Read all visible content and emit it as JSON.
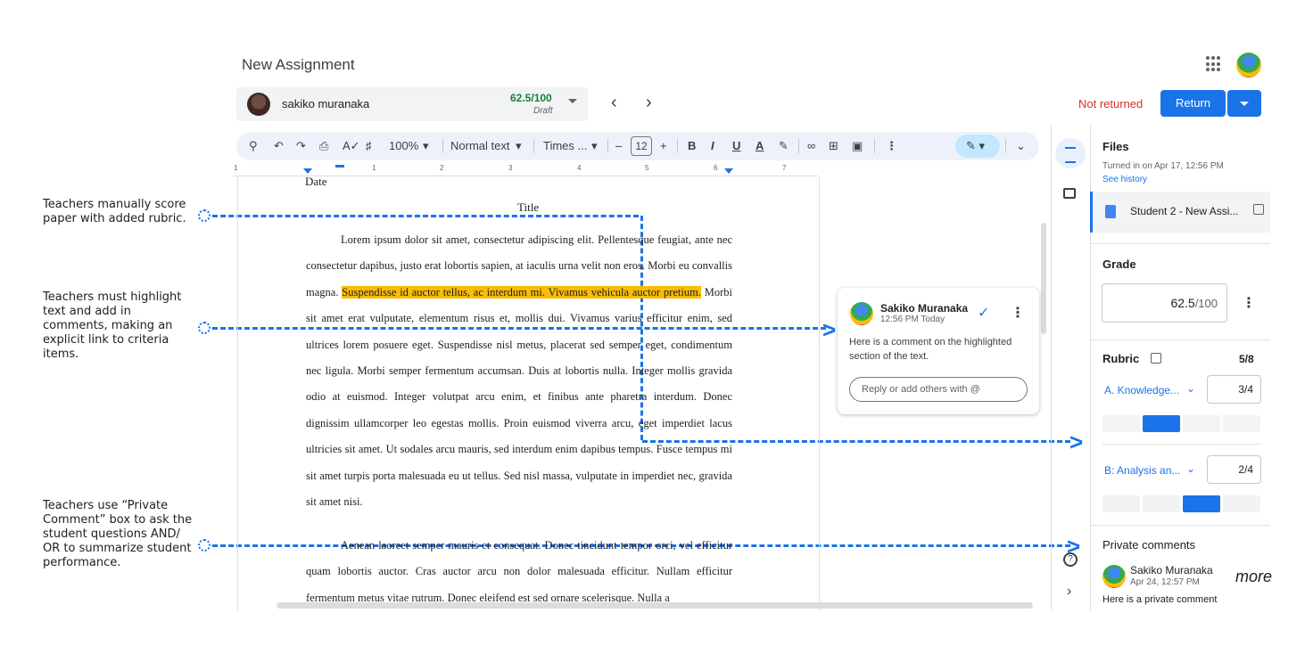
{
  "annotations": [
    {
      "text": "Teachers manually score paper with added rubric."
    },
    {
      "text": "Teachers must highlight text and add in comments, making an explicit link to criteria items."
    },
    {
      "text": "Teachers use “Private Comment” box to ask the student questions AND/ OR to summarize student performance."
    }
  ],
  "header": {
    "title": "New Assignment",
    "status": "Not returned",
    "return_label": "Return"
  },
  "student": {
    "name": "sakiko muranaka",
    "score": "62.5/100",
    "state": "Draft"
  },
  "toolbar": {
    "zoom": "100%",
    "style": "Normal text",
    "font": "Times ...",
    "size": "12",
    "bold": "B",
    "italic": "I",
    "underline": "U",
    "color": "A"
  },
  "ruler": [
    "1",
    "1",
    "2",
    "3",
    "4",
    "5",
    "6",
    "7"
  ],
  "document": {
    "date": "Date",
    "title": "Title",
    "p1_pre": "Lorem ipsum dolor sit amet, consectetur adipiscing elit. Pellentesque feugiat, ante nec consectetur dapibus, justo erat lobortis sapien, at iaculis urna velit non eros. Morbi eu convallis magna. ",
    "p1_highlight": "Suspendisse id auctor tellus, ac interdum mi. Vivamus vehicula auctor pretium.",
    "p1_post": " Morbi sit amet erat vulputate, elementum risus et, mollis dui. Vivamus varius efficitur enim, sed ultrices lorem posuere eget. Suspendisse nisl metus, placerat sed semper eget, condimentum nec ligula. Morbi semper fermentum accumsan. Duis at lobortis nulla. Integer mollis gravida odio at euismod. Integer volutpat arcu enim, et finibus ante pharetra interdum. Donec dignissim ullamcorper leo egestas mollis. Proin euismod viverra arcu, eget imperdiet lacus ultricies sit amet. Ut sodales arcu mauris, sed interdum enim dapibus tempus. Fusce tempus mi sit amet turpis porta malesuada eu ut tellus. Sed nisl massa, vulputate in imperdiet nec, gravida sit amet nisi.",
    "p2": "Aenean laoreet semper mauris et consequat. Donec tincidunt tempor orci, vel efficitur quam lobortis auctor. Cras auctor arcu non dolor malesuada efficitur. Nullam efficitur fermentum metus vitae rutrum. Donec eleifend est sed ornare scelerisque. Nulla a"
  },
  "comment": {
    "author": "Sakiko Muranaka",
    "time": "12:56 PM Today",
    "body": "Here is a comment on the highlighted section of the text.",
    "reply_placeholder": "Reply or add others with @"
  },
  "panel": {
    "files_title": "Files",
    "turned_in": "Turned in on Apr 17, 12:56 PM",
    "see_history": "See history",
    "file_name": "Student 2 - New Assi...",
    "grade_title": "Grade",
    "grade_value": "62.5",
    "grade_total": "/100",
    "rubric_title": "Rubric",
    "rubric_score": "5/8",
    "criteria": [
      {
        "label": "A. Knowledge...",
        "score": "3/4",
        "selected_level": 2,
        "levels": 4
      },
      {
        "label": "B: Analysis an...",
        "score": "2/4",
        "selected_level": 3,
        "levels": 4
      }
    ],
    "private_title": "Private comments",
    "private_author": "Sakiko Muranaka",
    "private_time": "Apr 24, 12:57 PM",
    "private_body": "Here is a private comment",
    "more": "more"
  },
  "icons": [
    "search-icon",
    "undo-icon",
    "redo-icon",
    "print-icon",
    "spellcheck-icon",
    "paint-format-icon",
    "link-icon",
    "add-comment-icon",
    "image-icon",
    "more-icon",
    "edit-mode-icon",
    "chevron-up-icon",
    "apps-icon",
    "check-icon",
    "open-external-icon",
    "help-icon"
  ],
  "colors": {
    "accent": "#1a73e8",
    "highlight": "#fbbc04",
    "danger": "#d93025",
    "score": "#188038"
  }
}
